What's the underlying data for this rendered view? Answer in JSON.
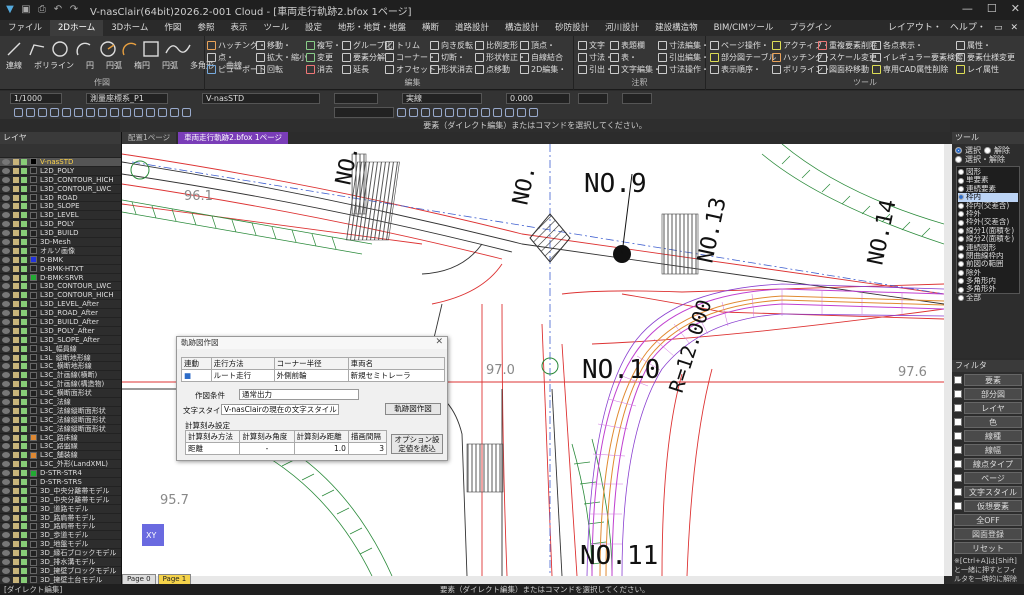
{
  "app": {
    "title": "V-nasClair(64bit)2026.2-001 Cloud - [車両走行軌跡2.bfox 1ページ]",
    "win": [
      "—",
      "☐",
      "✕"
    ]
  },
  "menu": {
    "tabs": [
      "ファイル",
      "2Dホーム",
      "3Dホーム",
      "作図",
      "参照",
      "表示",
      "ツール",
      "設定",
      "地形・地質・地盤",
      "横断",
      "道路設計",
      "構造設計",
      "砂防設計",
      "河川設計",
      "建設構造物",
      "BIM/CIMツール",
      "プラグイン"
    ],
    "right": [
      "レイアウト・",
      "ヘルプ・",
      "▭",
      "✕"
    ]
  },
  "ribbon": {
    "draw_labels": [
      "連線",
      "ポリライン",
      "円",
      "円弧",
      "楕円",
      "円弧",
      "多角形",
      "曲線"
    ],
    "group_sakuzu": "作図",
    "group_henshu": "編集",
    "group_chuki": "注釈",
    "group_tool": "ツール",
    "b1": [
      "ハッチング・",
      "点・",
      "ピューポート"
    ],
    "b2": [
      "移動・",
      "拡大・縮小",
      "回転"
    ],
    "b3": [
      "複写・",
      "変更",
      "消去"
    ],
    "b4": [
      "グループ化",
      "要素分解",
      "延長"
    ],
    "b5": [
      "トリム",
      "コーナー・",
      "オフセット・"
    ],
    "b6": [
      "向き反転",
      "切断・",
      "形状消去"
    ],
    "b7": [
      "比例変形",
      "形状修正・",
      "点移動"
    ],
    "b8": [
      "頂点・",
      "自線結合",
      "2D編集・"
    ],
    "b9": [
      "文字",
      "寸法・",
      "引出・"
    ],
    "b10": [
      "表題欄",
      "表・",
      "文字編集・"
    ],
    "b11": [
      "寸法編集・",
      "引出編集・",
      "寸法操作・"
    ],
    "b12": [
      "ページ操作・",
      "部分図テーブル",
      "表示順序・"
    ],
    "b13": [
      "アクティブ・",
      "ハッチング・",
      "ポリライン・"
    ],
    "b14": [
      "重複要素削除",
      "スケール変更",
      "図面枠移動"
    ],
    "b15": [
      "各点表示・",
      "イレギュラー要素検索",
      "専用CAD属性削除"
    ],
    "b16": [
      "属性・",
      "要素仕様変更",
      "レイ属性"
    ]
  },
  "props": {
    "scale": "1/1000",
    "layer": "測量座標系_P1",
    "style": "V-nasSTD",
    "font": "実線",
    "width": "0.000"
  },
  "hint": "要素（ダイレクト編集）またはコマンドを選択してください。",
  "layers": {
    "title": "レイヤ",
    "items": [
      {
        "name": "V-nasSTD",
        "color": "#000000",
        "sel": true
      },
      {
        "name": "L2D_POLY",
        "color": "#222222"
      },
      {
        "name": "L3D_CONTOUR_HICH",
        "color": "#222222"
      },
      {
        "name": "L3D_CONTOUR_LWC",
        "color": "#222222"
      },
      {
        "name": "L3D_ROAD",
        "color": "#222222"
      },
      {
        "name": "L3D_SLOPE",
        "color": "#222222"
      },
      {
        "name": "L3D_LEVEL",
        "color": "#222222"
      },
      {
        "name": "L3D_POLY",
        "color": "#222222"
      },
      {
        "name": "L3D_BUILD",
        "color": "#222222"
      },
      {
        "name": "3D-Mesh",
        "color": "#222222"
      },
      {
        "name": "オルソ画像",
        "color": "#222222"
      },
      {
        "name": "D-BMK",
        "color": "#2233dd"
      },
      {
        "name": "D-BMK-HTXT",
        "color": "#222222"
      },
      {
        "name": "D-BMK-SRVR",
        "color": "#22aa33"
      },
      {
        "name": "L3D_CONTOUR_LWC",
        "color": "#222222"
      },
      {
        "name": "L3D_CONTOUR_HICH",
        "color": "#222222"
      },
      {
        "name": "L3D_LEVEL_After",
        "color": "#222222"
      },
      {
        "name": "L3D_ROAD_After",
        "color": "#222222"
      },
      {
        "name": "L3D_BUILD_After",
        "color": "#222222"
      },
      {
        "name": "L3D_POLY_After",
        "color": "#222222"
      },
      {
        "name": "L3D_SLOPE_After",
        "color": "#222222"
      },
      {
        "name": "L3L_幅員線",
        "color": "#222222"
      },
      {
        "name": "L3L_縦断地形線",
        "color": "#222222"
      },
      {
        "name": "L3C_横断地形線",
        "color": "#222222"
      },
      {
        "name": "L3C_計画線(横断)",
        "color": "#222222"
      },
      {
        "name": "L3C_計画線(構造物)",
        "color": "#222222"
      },
      {
        "name": "L3C_横断面形状",
        "color": "#222222"
      },
      {
        "name": "L3C_法線",
        "color": "#222222"
      },
      {
        "name": "L3C_法線縦断面形状",
        "color": "#222222"
      },
      {
        "name": "L3C_法線縦断面形状",
        "color": "#222222"
      },
      {
        "name": "L3C_法線縦断面形状",
        "color": "#222222"
      },
      {
        "name": "L3C_路床線",
        "color": "#dd8833"
      },
      {
        "name": "L3C_路盤線",
        "color": "#222222"
      },
      {
        "name": "L3C_舗装線",
        "color": "#dd8833"
      },
      {
        "name": "L3C_外形(LandXML)",
        "color": "#222222"
      },
      {
        "name": "D-STR-STR4",
        "color": "#22aa33"
      },
      {
        "name": "D-STR-STRS",
        "color": "#222222"
      },
      {
        "name": "3D_中央分離帯モデル",
        "color": "#222222"
      },
      {
        "name": "3D_中央分離帯モデル",
        "color": "#222222"
      },
      {
        "name": "3D_道路モデル",
        "color": "#222222"
      },
      {
        "name": "3D_路肩帯モデル",
        "color": "#222222"
      },
      {
        "name": "3D_路肩帯モデル",
        "color": "#222222"
      },
      {
        "name": "3D_歩道モデル",
        "color": "#222222"
      },
      {
        "name": "3D_地盤モデル",
        "color": "#222222"
      },
      {
        "name": "3D_縁石ブロックモデル",
        "color": "#222222"
      },
      {
        "name": "3D_排水溝モデル",
        "color": "#222222"
      },
      {
        "name": "3D_擁壁ブロックモデル",
        "color": "#222222"
      },
      {
        "name": "3D_擁壁土台モデル",
        "color": "#222222"
      }
    ]
  },
  "canvas_tabs": [
    "配置1ページ",
    "車両走行軌跡2.bfox 1ページ"
  ],
  "page_tabs": [
    "Page 0",
    "Page 1"
  ],
  "drawing": {
    "labels": {
      "no9": "NO.9",
      "no10": "NO.10",
      "no11": "NO.11",
      "no13": "NO.13",
      "no14": "NO.14",
      "noc": "NO.",
      "no_top": "NO.",
      "r12": "R=12.000",
      "e961": "96.1",
      "e970": "97.0",
      "e976": "97.6",
      "e957": "95.7",
      "xy": "XY"
    }
  },
  "dialog": {
    "title": "軌跡図作図",
    "close": "✕",
    "headers": [
      "連動",
      "走行方法",
      "コーナー半径",
      "車両名"
    ],
    "row": {
      "check": "■",
      "method": "ルート走行",
      "corner": "外側前輪",
      "vehicle": "新規セミトレーラ"
    },
    "cond_label": "作図条件",
    "cond_value": "通常出力",
    "style_label": "文字スタイル",
    "style_value": "V-nasClairの現在の文字スタイル",
    "draw_btn": "軌跡図作図",
    "calc_label": "計算刻み設定",
    "calc_headers": [
      "計算刻み方法",
      "計算刻み角度",
      "計算刻み距離",
      "描画間隔"
    ],
    "calc_values": [
      "距離",
      "-",
      "1.0",
      "3"
    ],
    "option_btn": "オプション設定値を読込"
  },
  "tools": {
    "title": "ツール",
    "radios": [
      {
        "label": "選択",
        "on": true
      },
      {
        "label": "解除",
        "on": false
      },
      {
        "label": "選択・解除",
        "on": false
      }
    ],
    "items": [
      "図形",
      "単要素",
      "連続要素",
      "枠内",
      "枠内(交差含)",
      "枠外",
      "枠外(交差含)",
      "線分1(面積を)",
      "線分2(面積を)",
      "連続図形",
      "閉曲線枠内",
      "前図の範囲",
      "除外",
      "多角形内",
      "多角形外",
      "全部"
    ],
    "selected": "枠内"
  },
  "filter": {
    "title": "フィルタ",
    "items": [
      "要素",
      "部分図",
      "レイヤ",
      "色",
      "線種",
      "線幅",
      "線点タイプ",
      "ページ",
      "文字スタイル",
      "仮想要素"
    ],
    "all_off": "全OFF",
    "reg": "図面登録",
    "reset": "リセット",
    "note": "※[Ctrl+A]は[Shift]と一緒に押すとフィルタを一時的に解除出来ます。"
  },
  "status": {
    "left": "[ダイレクト編集]",
    "center": "要素（ダイレクト編集）またはコマンドを選択してください。"
  }
}
